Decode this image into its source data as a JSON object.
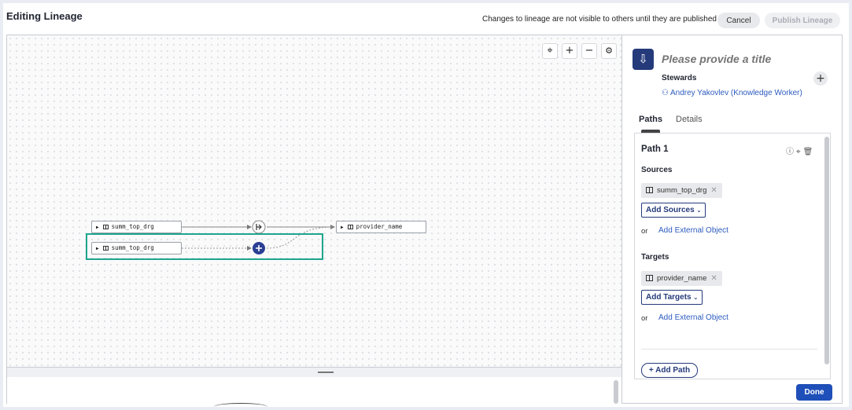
{
  "header": {
    "title": "Editing Lineage",
    "note": "Changes to lineage are not visible to others until they are published",
    "cancel_label": "Cancel",
    "publish_label": "Publish Lineage"
  },
  "canvas": {
    "toolbar": {
      "center_icon": "⌖",
      "zoom_in_icon": "+",
      "zoom_out_icon": "−",
      "settings_icon": "⚙"
    },
    "nodes": [
      {
        "label": "summ_top_drg"
      },
      {
        "label": "summ_top_drg"
      },
      {
        "label": "provider_name"
      }
    ],
    "icons": {
      "lineage_icon": "lineage-icon",
      "add_icon": "plus-icon",
      "table_icon": "table-icon"
    },
    "colors": {
      "highlight": "#1fa58e",
      "add_node": "#2b3f94"
    }
  },
  "panel": {
    "title_placeholder": "Please provide a title",
    "stewards_label": "Stewards",
    "steward_name": "Andrey Yakovlev (Knowledge Worker)",
    "tabs": [
      {
        "label": "Paths"
      },
      {
        "label": "Details"
      }
    ],
    "path": {
      "title": "Path 1",
      "sources_label": "Sources",
      "source_chip": "summ_top_drg",
      "add_sources": "Add Sources",
      "or": "or",
      "add_external_1": "Add External Object",
      "targets_label": "Targets",
      "target_chip": "provider_name",
      "add_targets": "Add Targets",
      "add_external_2": "Add External Object"
    },
    "add_path": "+ Add Path",
    "done": "Done"
  }
}
